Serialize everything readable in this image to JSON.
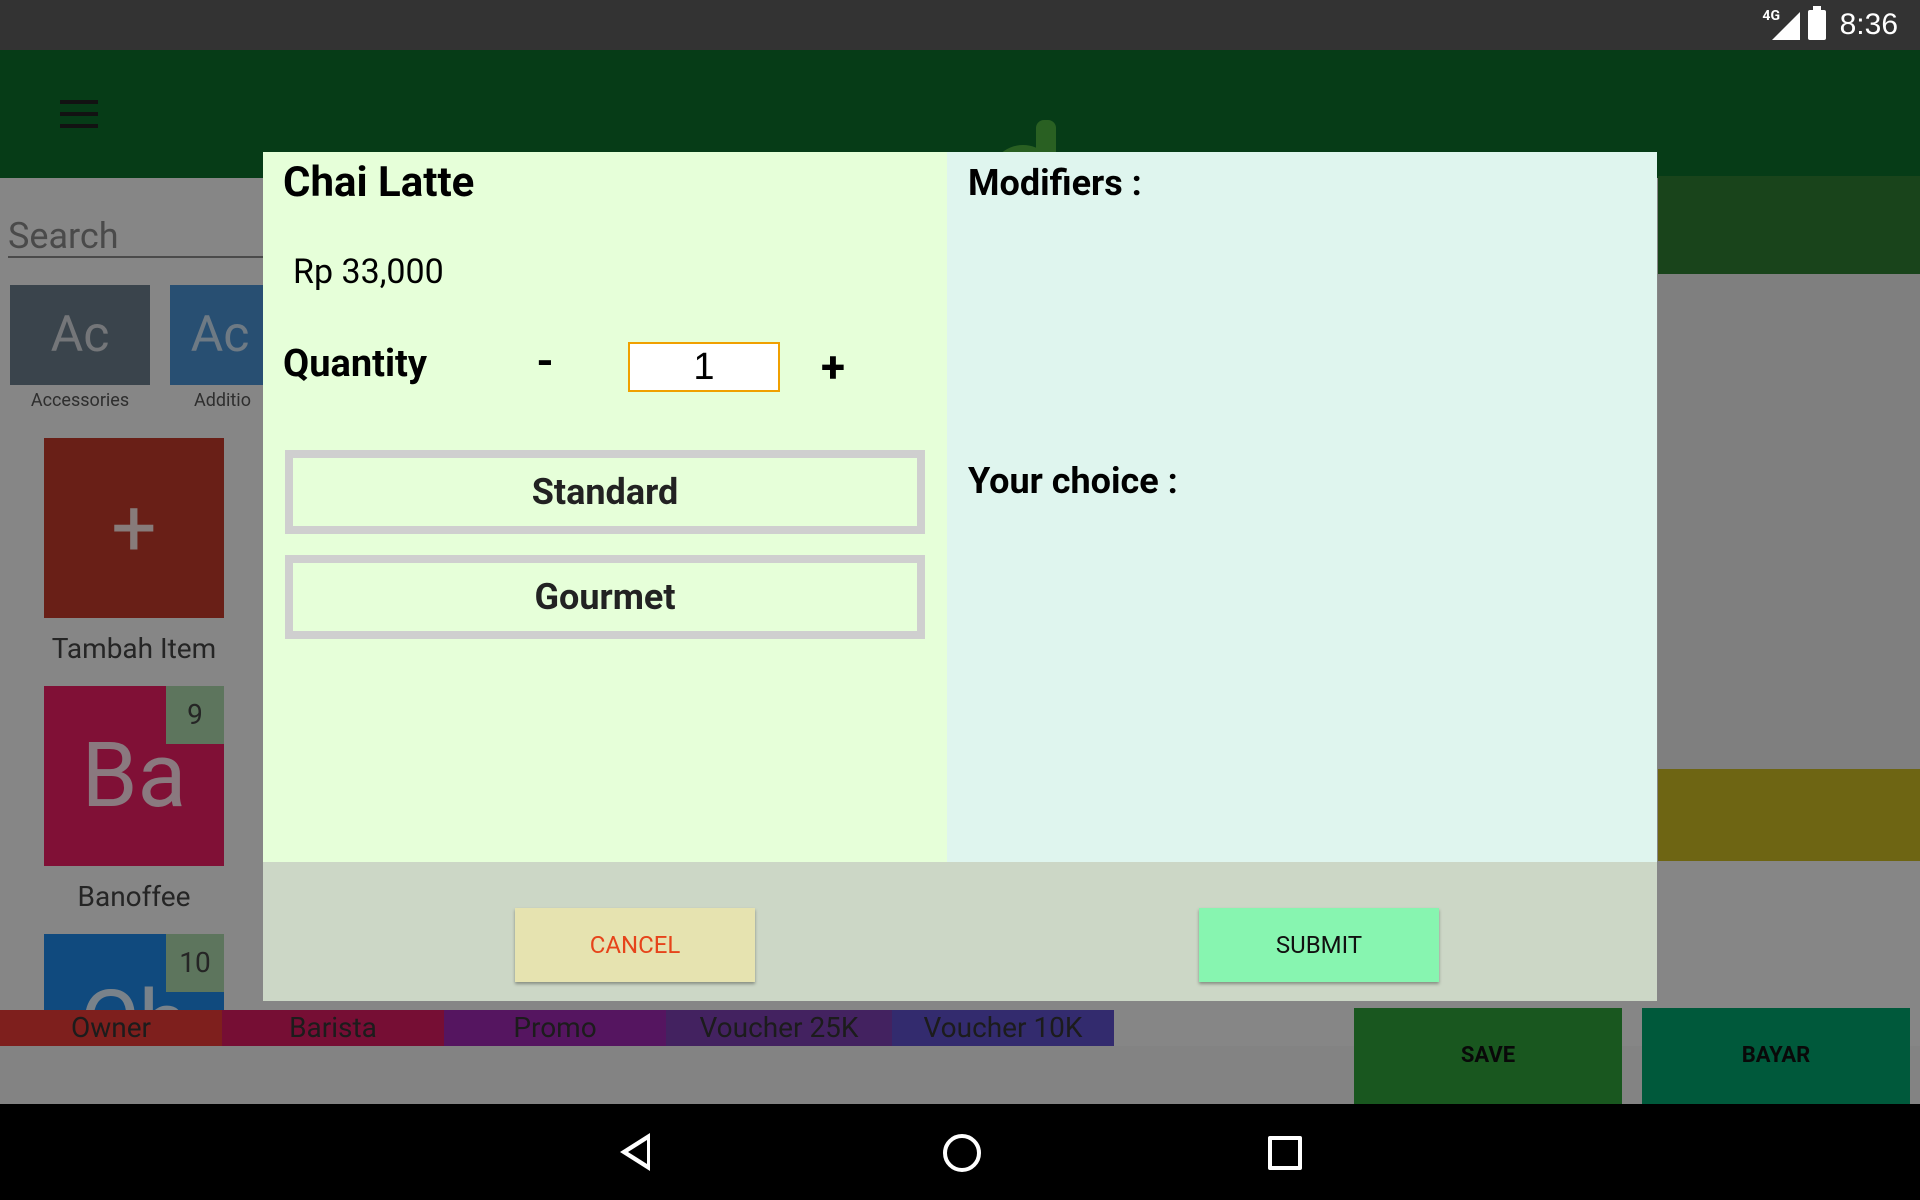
{
  "status_bar": {
    "network": "4G",
    "time": "8:36"
  },
  "search": {
    "placeholder": "Search"
  },
  "categories": [
    {
      "abbr": "Ac",
      "label": "Accessories",
      "color": "#6b7d8a"
    },
    {
      "abbr": "Ac",
      "label": "Additio",
      "color": "#4a90d0"
    }
  ],
  "tiles": [
    {
      "symbol": "+",
      "label": "Tambah Item",
      "color": "#c0392b"
    },
    {
      "symbol": "Ba",
      "label": "Banoffee",
      "badge": "9",
      "color": "#e91e63"
    },
    {
      "symbol": "Ch",
      "badge": "10",
      "color": "#1e88e5"
    }
  ],
  "bottom_tabs": [
    "Owner",
    "Barista",
    "Promo",
    "Voucher 25K",
    "Voucher 10K"
  ],
  "actions": {
    "save": "SAVE",
    "bayar": "BAYAR"
  },
  "dialog": {
    "title": "Chai Latte",
    "price": "Rp 33,000",
    "quantity_label": "Quantity",
    "minus": "-",
    "quantity": "1",
    "plus": "+",
    "options": [
      "Standard",
      "Gourmet"
    ],
    "modifiers_label": "Modifiers :",
    "choice_label": "Your choice :",
    "cancel": "CANCEL",
    "submit": "SUBMIT"
  }
}
